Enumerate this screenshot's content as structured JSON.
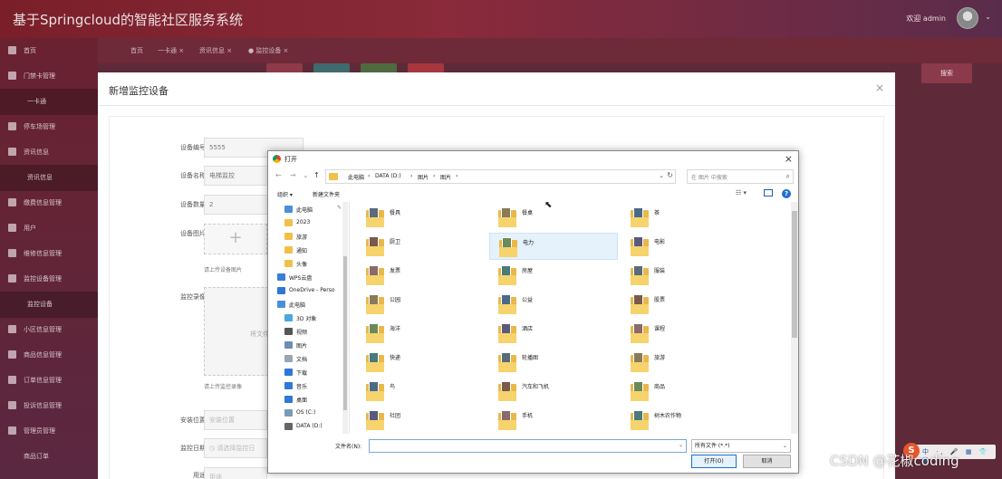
{
  "app": {
    "title": "基于Springcloud的智能社区服务系统",
    "welcome": "欢迎 admin",
    "user_menu_chevron": "⌄"
  },
  "sidebar": {
    "items": [
      {
        "label": "首页",
        "icon": "home-icon",
        "sub": false
      },
      {
        "label": "门禁卡管理",
        "icon": "grid-icon",
        "sub": false
      },
      {
        "label": "一卡通",
        "icon": "",
        "sub": true
      },
      {
        "label": "停车场管理",
        "icon": "grid-icon",
        "sub": false
      },
      {
        "label": "资讯信息",
        "icon": "list-icon",
        "sub": false
      },
      {
        "label": "资讯信息",
        "icon": "",
        "sub": true
      },
      {
        "label": "缴费信息管理",
        "icon": "chart-icon",
        "sub": false
      },
      {
        "label": "用户",
        "icon": "user-icon",
        "sub": false
      },
      {
        "label": "维修信息管理",
        "icon": "list-icon",
        "sub": false
      },
      {
        "label": "监控设备管理",
        "icon": "list-icon",
        "sub": false
      },
      {
        "label": "监控设备",
        "icon": "",
        "sub": true
      },
      {
        "label": "小区信息管理",
        "icon": "grid-icon",
        "sub": false
      },
      {
        "label": "商品信息管理",
        "icon": "chart-icon",
        "sub": false
      },
      {
        "label": "订单信息管理",
        "icon": "list-icon",
        "sub": false
      },
      {
        "label": "投诉信息管理",
        "icon": "image-icon",
        "sub": false
      },
      {
        "label": "管理员管理",
        "icon": "grid-icon",
        "sub": false
      },
      {
        "label": "商品订单",
        "icon": "",
        "sub": false
      }
    ]
  },
  "tabs": [
    "首页",
    "一卡通 ×",
    "资讯信息 ×",
    "● 监控设备 ×"
  ],
  "toolbar": {
    "search_button": "搜索"
  },
  "modal": {
    "title": "新增监控设备",
    "close": "×",
    "fields": {
      "device_no_label": "设备编号",
      "device_no_value": "5555",
      "device_name_label": "设备名称",
      "device_name_value": "电梯监控",
      "device_qty_label": "设备数量",
      "device_qty_value": "2",
      "device_image_label": "设备图片",
      "device_image_plus": "+",
      "device_image_hint": "请上传设备图片",
      "video_label": "监控录像",
      "video_drop_text": "将文件",
      "video_hint": "请上传监控录像",
      "location_label": "安装位置",
      "location_placeholder": "安装位置",
      "date_label": "监控日期",
      "date_placeholder": "◷ 请选择监控日",
      "usage_label": "用途",
      "usage_placeholder": "用途"
    }
  },
  "dialog": {
    "title": "打开",
    "close": "×",
    "nav": {
      "back": "←",
      "forward": "→",
      "recent": "⌄",
      "up": "↑"
    },
    "breadcrumb": [
      "此电脑",
      "›",
      "DATA (D:)",
      "›",
      "图片",
      "›",
      "图片",
      "›"
    ],
    "address_dropdown": "⌄",
    "address_refresh": "↻",
    "search_placeholder": "在 图片 中搜索",
    "organize": "组织 ▾",
    "new_folder": "新建文件夹",
    "view_toggle": "☷ ▾",
    "help": "?",
    "pin": "📌",
    "tree": [
      {
        "label": "此电脑",
        "icon_color": "#4a8fd8",
        "indent": 4
      },
      {
        "label": "2023",
        "icon_color": "#f0c04a",
        "indent": 4
      },
      {
        "label": "旅游",
        "icon_color": "#f0c04a",
        "indent": 4
      },
      {
        "label": "通知",
        "icon_color": "#f0c04a",
        "indent": 4
      },
      {
        "label": "头像",
        "icon_color": "#f0c04a",
        "indent": 4
      },
      {
        "label": "WPS云盘",
        "icon_color": "#3a7fd5",
        "indent": 0
      },
      {
        "label": "OneDrive - Perso",
        "icon_color": "#2e78d6",
        "indent": 0
      },
      {
        "label": "此电脑",
        "icon_color": "#4a8fd8",
        "indent": 0
      },
      {
        "label": "3D 对象",
        "icon_color": "#4aa8e0",
        "indent": 4
      },
      {
        "label": "视频",
        "icon_color": "#555555",
        "indent": 4
      },
      {
        "label": "图片",
        "icon_color": "#6f8db0",
        "indent": 4
      },
      {
        "label": "文档",
        "icon_color": "#9aa6b2",
        "indent": 4
      },
      {
        "label": "下载",
        "icon_color": "#2e78d6",
        "indent": 4
      },
      {
        "label": "音乐",
        "icon_color": "#2e78d6",
        "indent": 4
      },
      {
        "label": "桌面",
        "icon_color": "#2e78d6",
        "indent": 4
      },
      {
        "label": "OS (C:)",
        "icon_color": "#7a9ab8",
        "indent": 4
      },
      {
        "label": "DATA (D:)",
        "icon_color": "#666666",
        "indent": 4
      }
    ],
    "files": [
      [
        "餐具",
        "餐桌",
        "茶"
      ],
      [
        "厨卫",
        "电力",
        "电影"
      ],
      [
        "发票",
        "房屋",
        "服装"
      ],
      [
        "公园",
        "公益",
        "股票"
      ],
      [
        "海洋",
        "酒店",
        "课程"
      ],
      [
        "快递",
        "轮播图",
        "旅游"
      ],
      [
        "鸟",
        "汽车和飞机",
        "商品"
      ],
      [
        "社团",
        "手机",
        "树木农作物"
      ]
    ],
    "selected_file": "电力",
    "cursor": "⬉",
    "filename_label": "文件名(N):",
    "filename_value": "",
    "filename_dropdown": "⌄",
    "filetype_value": "所有文件 (*.*)",
    "filetype_dropdown": "⌄",
    "open_button": "打开(O)",
    "cancel_button": "取消"
  },
  "watermark": "CSDN @花椒coding",
  "ime": {
    "logo": "S",
    "text": "中 ·, 🎤 ▦ 👕 ▦"
  }
}
